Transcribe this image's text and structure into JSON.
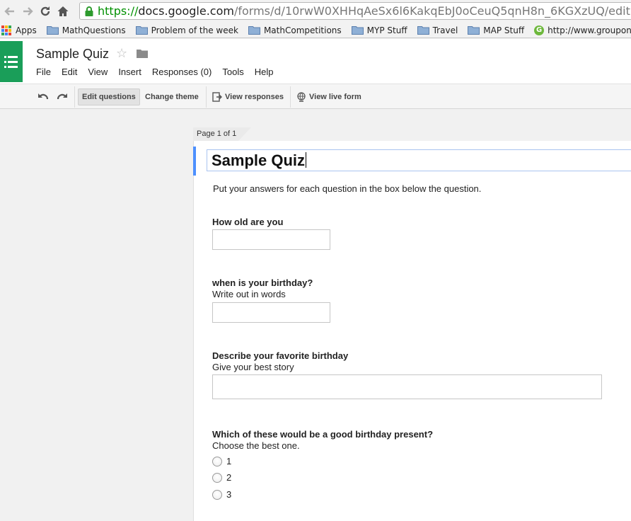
{
  "browser": {
    "url_protocol": "https://",
    "url_host": "docs.google.com",
    "url_path": "/forms/d/10rwW0XHHqAeSx6l6KakqEbJ0oCeuQ5qnH8n_6KGXzUQ/edit",
    "bookmarks": [
      "Apps",
      "MathQuestions",
      "Problem of the week",
      "MathCompetitions",
      "MYP Stuff",
      "Travel",
      "MAP Stuff",
      "http://www.groupon"
    ]
  },
  "header": {
    "doc_title": "Sample Quiz",
    "menu": [
      "File",
      "Edit",
      "View",
      "Insert",
      "Responses (0)",
      "Tools",
      "Help"
    ]
  },
  "toolbar": {
    "edit_questions": "Edit questions",
    "change_theme": "Change theme",
    "view_responses": "View responses",
    "view_live_form": "View live form"
  },
  "form": {
    "page_label": "Page 1 of 1",
    "title": "Sample Quiz",
    "description": "Put your answers for each question in the box below the question.",
    "questions": [
      {
        "title": "How old are you",
        "help": ""
      },
      {
        "title": "when is your birthday?",
        "help": "Write out in words"
      },
      {
        "title": "Describe your favorite birthday",
        "help": "Give your best story"
      },
      {
        "title": "Which of these would be a good birthday present?",
        "help": "Choose the best one.",
        "options": [
          "1",
          "2",
          "3"
        ]
      }
    ]
  },
  "colors": {
    "forms_green": "#1a9e59",
    "url_green": "#009000",
    "focus_blue": "#4d90fe"
  }
}
